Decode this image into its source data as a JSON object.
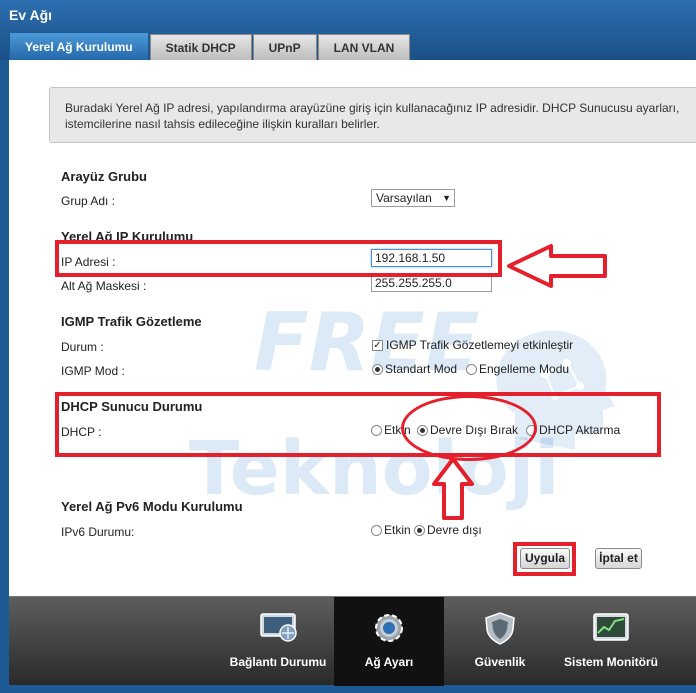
{
  "app": {
    "title": "Ev Ağı"
  },
  "tabs": [
    {
      "label": "Yerel Ağ Kurulumu",
      "active": true
    },
    {
      "label": "Statik DHCP",
      "active": false
    },
    {
      "label": "UPnP",
      "active": false
    },
    {
      "label": "LAN VLAN",
      "active": false
    }
  ],
  "info": {
    "line1": "Buradaki Yerel Ağ IP adresi, yapılandırma arayüzüne giriş için kullanacağınız IP adresidir. DHCP Sunucusu ayarları,",
    "line2": "istemcilerine nasıl tahsis edileceğine ilişkin kuralları belirler."
  },
  "interface_group": {
    "title": "Arayüz Grubu",
    "group_label": "Grup Adı :",
    "group_value": "Varsayılan",
    "arrow": "▼"
  },
  "lan_ip": {
    "title": "Yerel Ağ IP Kurulumu",
    "ip_label": "IP Adresi :",
    "ip_value": "192.168.1.50",
    "mask_label": "Alt Ağ Maskesi :",
    "mask_value": "255.255.255.0"
  },
  "igmp": {
    "title": "IGMP Trafik Gözetleme",
    "status_label": "Durum :",
    "enable_label": "IGMP Trafik Gözetlemeyi etkinleştir",
    "enable_checked": true,
    "check_glyph": "✓",
    "mode_label": "IGMP Mod :",
    "mode_options": [
      {
        "label": "Standart Mod",
        "selected": true
      },
      {
        "label": "Engelleme Modu",
        "selected": false
      }
    ]
  },
  "dhcp": {
    "title": "DHCP Sunucu Durumu",
    "label": "DHCP :",
    "options": [
      {
        "label": "Etkin",
        "selected": false
      },
      {
        "label": "Devre Dışı Bırak",
        "selected": true
      },
      {
        "label": "DHCP Aktarma",
        "selected": false
      }
    ]
  },
  "ipv6": {
    "title": "Yerel Ağ Pv6 Modu Kurulumu",
    "label": "IPv6 Durumu:",
    "options": [
      {
        "label": "Etkin",
        "selected": false
      },
      {
        "label": "Devre dışı",
        "selected": true
      }
    ]
  },
  "buttons": {
    "apply": "Uygula",
    "cancel": "İptal et"
  },
  "watermark": {
    "line1": "FREE",
    "line2": "Teknoloji"
  },
  "nav": [
    {
      "label": "Bağlantı Durumu",
      "icon": "connection-status-icon",
      "active": false
    },
    {
      "label": "Ağ Ayarı",
      "icon": "network-settings-gear-icon",
      "active": true
    },
    {
      "label": "Güvenlik",
      "icon": "security-shield-icon",
      "active": false
    },
    {
      "label": "Sistem Monitörü",
      "icon": "system-monitor-icon",
      "active": false
    }
  ],
  "colors": {
    "accent_blue": "#2468a9",
    "annotation_red": "#e3202b",
    "taskbar_dark": "#2a2a2a"
  }
}
